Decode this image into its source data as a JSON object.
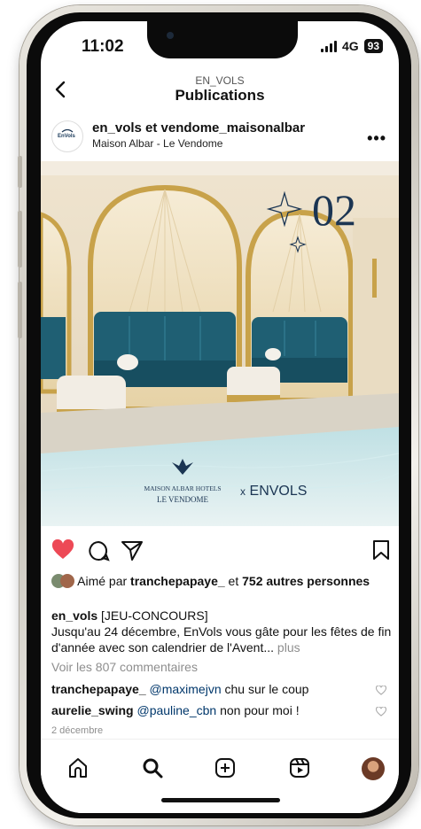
{
  "status": {
    "time": "11:02",
    "network": "4G",
    "battery": "93"
  },
  "header": {
    "account": "EN_VOLS",
    "title": "Publications"
  },
  "post": {
    "avatar_text": "EnVols",
    "user": "en_vols et vendome_maisonalbar",
    "location": "Maison Albar - Le Vendome",
    "image": {
      "number": "02",
      "brand_line1": "MAISON ALBAR HOTELS",
      "brand_line2": "LE VENDOME",
      "cross": "x",
      "partner": "ENVOLS"
    },
    "liked_prefix": "Aimé par",
    "liked_by": "tranchepapaye_",
    "liked_and": "et",
    "liked_count": "752 autres personnes",
    "caption_user": "en_vols",
    "caption_line1": "[JEU-CONCOURS]",
    "caption_text": "Jusqu'au 24 décembre, EnVols vous gâte pour les fêtes de fin d'année avec son calendrier de l'Avent...",
    "caption_more": "plus",
    "view_comments": "Voir les 807 commentaires",
    "comments": [
      {
        "user": "tranchepapaye_",
        "mention": "@maximejvn",
        "text": "chu sur le coup"
      },
      {
        "user": "aurelie_swing",
        "mention": "@pauline_cbn",
        "text": "non pour moi !"
      }
    ],
    "date": "2 décembre"
  },
  "colors": {
    "like_red": "#ed4956",
    "teal": "#1f5f73",
    "gold": "#c8a24a",
    "navy": "#1b3553"
  },
  "icons": [
    "back-icon",
    "heart-icon",
    "comment-icon",
    "share-icon",
    "bookmark-icon",
    "home-icon",
    "search-icon",
    "create-icon",
    "reels-icon",
    "profile-avatar"
  ]
}
